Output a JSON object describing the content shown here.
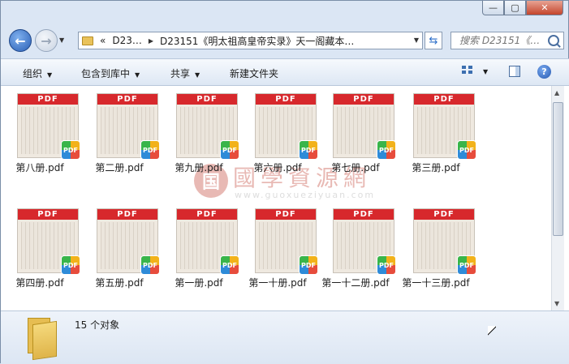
{
  "window": {
    "controls": {
      "minimize": "—",
      "maximize": "▢",
      "close": "✕"
    }
  },
  "address": {
    "crumbs": [
      "«",
      "D23…",
      "D23151《明太祖高皇帝实录》天一阁藏本…"
    ],
    "search_placeholder": "搜索 D23151《…"
  },
  "toolbar": {
    "organize": "组织",
    "include_in_library": "包含到库中",
    "share": "共享",
    "new_folder": "新建文件夹"
  },
  "files": [
    {
      "name": "第八册.pdf",
      "banner": "PDF",
      "badge": "PDF"
    },
    {
      "name": "第二册.pdf",
      "banner": "PDF",
      "badge": "PDF"
    },
    {
      "name": "第九册.pdf",
      "banner": "PDF",
      "badge": "PDF"
    },
    {
      "name": "第六册.pdf",
      "banner": "PDF",
      "badge": "PDF"
    },
    {
      "name": "第七册.pdf",
      "banner": "PDF",
      "badge": "PDF"
    },
    {
      "name": "第三册.pdf",
      "banner": "PDF",
      "badge": "PDF"
    },
    {
      "name": "第四册.pdf",
      "banner": "PDF",
      "badge": "PDF"
    },
    {
      "name": "第五册.pdf",
      "banner": "PDF",
      "badge": "PDF"
    },
    {
      "name": "第一册.pdf",
      "banner": "PDF",
      "badge": "PDF"
    },
    {
      "name": "第一十册.pdf",
      "banner": "PDF",
      "badge": "PDF"
    },
    {
      "name": "第一十二册.pdf",
      "banner": "PDF",
      "badge": "PDF"
    },
    {
      "name": "第一十三册.pdf",
      "banner": "PDF",
      "badge": "PDF"
    }
  ],
  "watermark": {
    "seal": "国",
    "title": "國學資源網",
    "url": "www.guoxueziyuan.com"
  },
  "status": {
    "count": "15 个对象"
  }
}
